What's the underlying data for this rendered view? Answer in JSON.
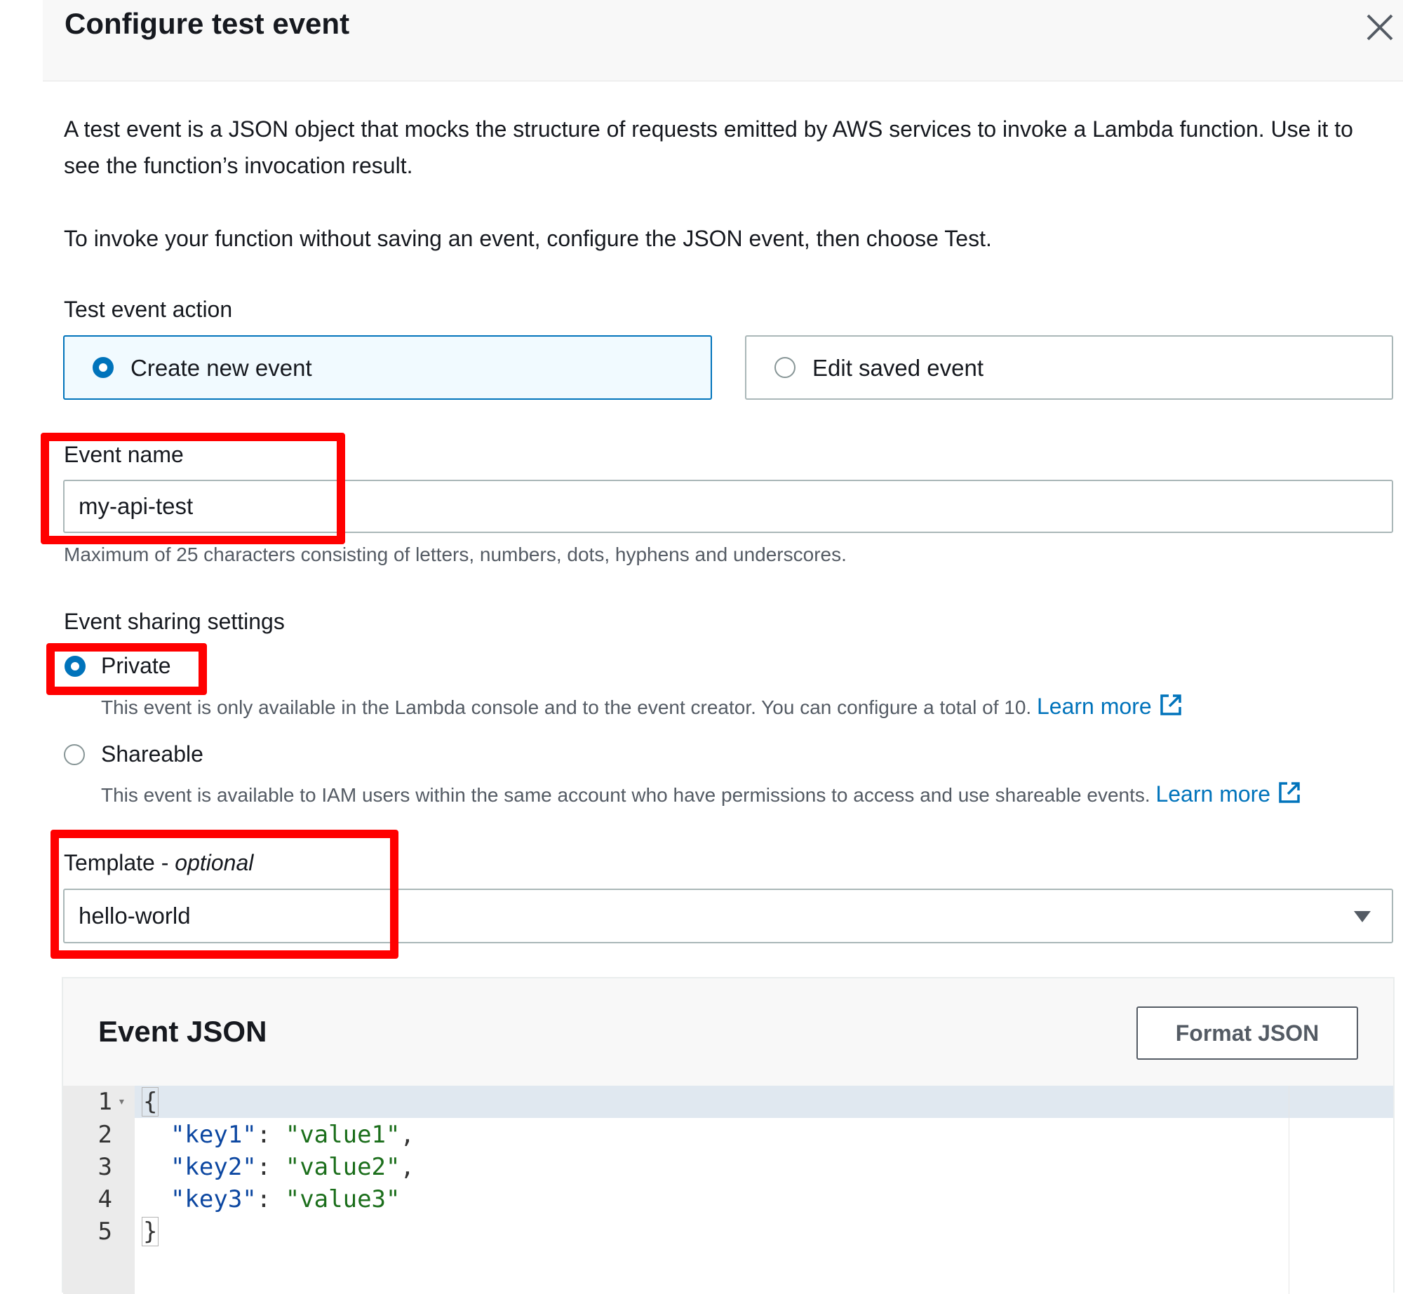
{
  "modal": {
    "title": "Configure test event"
  },
  "intro": {
    "paragraph1": "A test event is a JSON object that mocks the structure of requests emitted by AWS services to invoke a Lambda function. Use it to see the function’s invocation result.",
    "paragraph2": "To invoke your function without saving an event, configure the JSON event, then choose Test."
  },
  "test_event_action": {
    "label": "Test event action",
    "options": [
      {
        "label": "Create new event",
        "selected": true
      },
      {
        "label": "Edit saved event",
        "selected": false
      }
    ]
  },
  "event_name": {
    "label": "Event name",
    "value": "my-api-test",
    "hint": "Maximum of 25 characters consisting of letters, numbers, dots, hyphens and underscores."
  },
  "sharing": {
    "label": "Event sharing settings",
    "options": [
      {
        "label": "Private",
        "selected": true,
        "description": "This event is only available in the Lambda console and to the event creator. You can configure a total of 10.",
        "link": "Learn more"
      },
      {
        "label": "Shareable",
        "selected": false,
        "description": "This event is available to IAM users within the same account who have permissions to access and use shareable events.",
        "link": "Learn more"
      }
    ]
  },
  "template": {
    "label": "Template - ",
    "label_optional": "optional",
    "value": "hello-world"
  },
  "event_json": {
    "title": "Event JSON",
    "format_button": "Format JSON",
    "line_numbers": [
      "1",
      "2",
      "3",
      "4",
      "5"
    ],
    "lines": [
      {
        "open": "{"
      },
      {
        "key": "\"key1\"",
        "sep": ": ",
        "value": "\"value1\"",
        "end": ","
      },
      {
        "key": "\"key2\"",
        "sep": ": ",
        "value": "\"value2\"",
        "end": ","
      },
      {
        "key": "\"key3\"",
        "sep": ": ",
        "value": "\"value3\"",
        "end": ""
      },
      {
        "close": "}"
      }
    ]
  },
  "colors": {
    "accent": "#0073bb",
    "highlight": "#ff0000"
  },
  "icons": {
    "close": "close-icon",
    "external": "external-link-icon",
    "caret": "caret-down-icon"
  }
}
